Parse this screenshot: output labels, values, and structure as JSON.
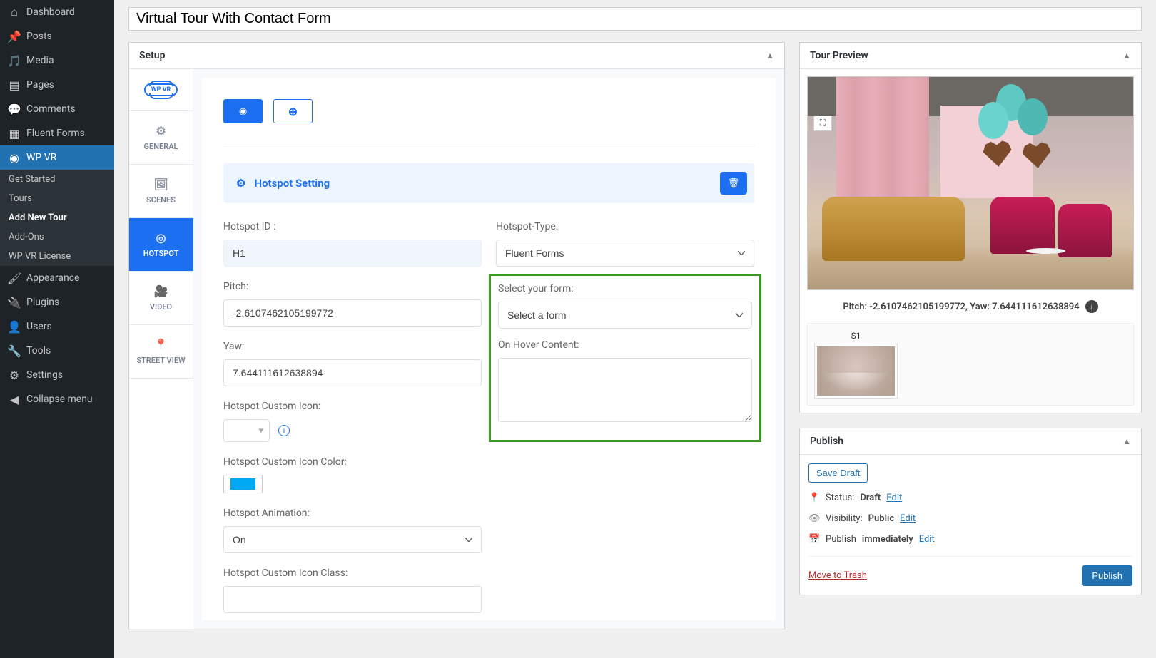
{
  "page_title": "Virtual Tour With Contact Form",
  "sidebar": {
    "items": [
      {
        "icon": "⌂",
        "label": "Dashboard"
      },
      {
        "icon": "✎",
        "label": "Posts"
      },
      {
        "icon": "🖼",
        "label": "Media"
      },
      {
        "icon": "▤",
        "label": "Pages"
      },
      {
        "icon": "💬",
        "label": "Comments"
      },
      {
        "icon": "▦",
        "label": "Fluent Forms"
      },
      {
        "icon": "◉",
        "label": "WP VR",
        "active": true
      },
      {
        "icon": "🎨",
        "label": "Appearance"
      },
      {
        "icon": "🔌",
        "label": "Plugins"
      },
      {
        "icon": "👤",
        "label": "Users"
      },
      {
        "icon": "🔧",
        "label": "Tools"
      },
      {
        "icon": "⚙",
        "label": "Settings"
      },
      {
        "icon": "◀",
        "label": "Collapse menu"
      }
    ],
    "wpvr_sub": [
      {
        "label": "Get Started"
      },
      {
        "label": "Tours"
      },
      {
        "label": "Add New Tour",
        "current": true
      },
      {
        "label": "Add-Ons"
      },
      {
        "label": "WP VR License"
      }
    ]
  },
  "setup": {
    "header": "Setup",
    "tabs": {
      "logo_text": "WP VR",
      "general": "GENERAL",
      "scenes": "SCENES",
      "hotspot": "HOTSPOT",
      "video": "VIDEO",
      "street": "STREET VIEW"
    },
    "hotspot_setting_title": "Hotspot Setting",
    "fields": {
      "hotspot_id_label": "Hotspot ID :",
      "hotspot_id_value": "H1",
      "hotspot_type_label": "Hotspot-Type:",
      "hotspot_type_value": "Fluent Forms",
      "pitch_label": "Pitch:",
      "pitch_value": "-2.6107462105199772",
      "yaw_label": "Yaw:",
      "yaw_value": "7.644111612638894",
      "select_form_label": "Select your form:",
      "select_form_value": "Select a form",
      "hover_label": "On Hover Content:",
      "hover_value": "",
      "custom_icon_label": "Hotspot Custom Icon:",
      "custom_icon_color_label": "Hotspot Custom Icon Color:",
      "custom_icon_color_value": "#00a9f4",
      "animation_label": "Hotspot Animation:",
      "animation_value": "On",
      "custom_icon_class_label": "Hotspot Custom Icon Class:",
      "custom_icon_class_value": ""
    }
  },
  "preview": {
    "header": "Tour Preview",
    "caption": "Pitch: -2.6107462105199772, Yaw: 7.644111612638894",
    "controls": {
      "zoom_in": "+",
      "zoom_out": "−",
      "fullscreen": "⛶"
    },
    "scenes": [
      {
        "label": "S1"
      }
    ]
  },
  "publish": {
    "header": "Publish",
    "save_draft": "Save Draft",
    "status_label": "Status:",
    "status_value": "Draft",
    "visibility_label": "Visibility:",
    "visibility_value": "Public",
    "publish_on_label": "Publish",
    "publish_on_value": "immediately",
    "edit": "Edit",
    "trash": "Move to Trash",
    "publish_btn": "Publish"
  }
}
